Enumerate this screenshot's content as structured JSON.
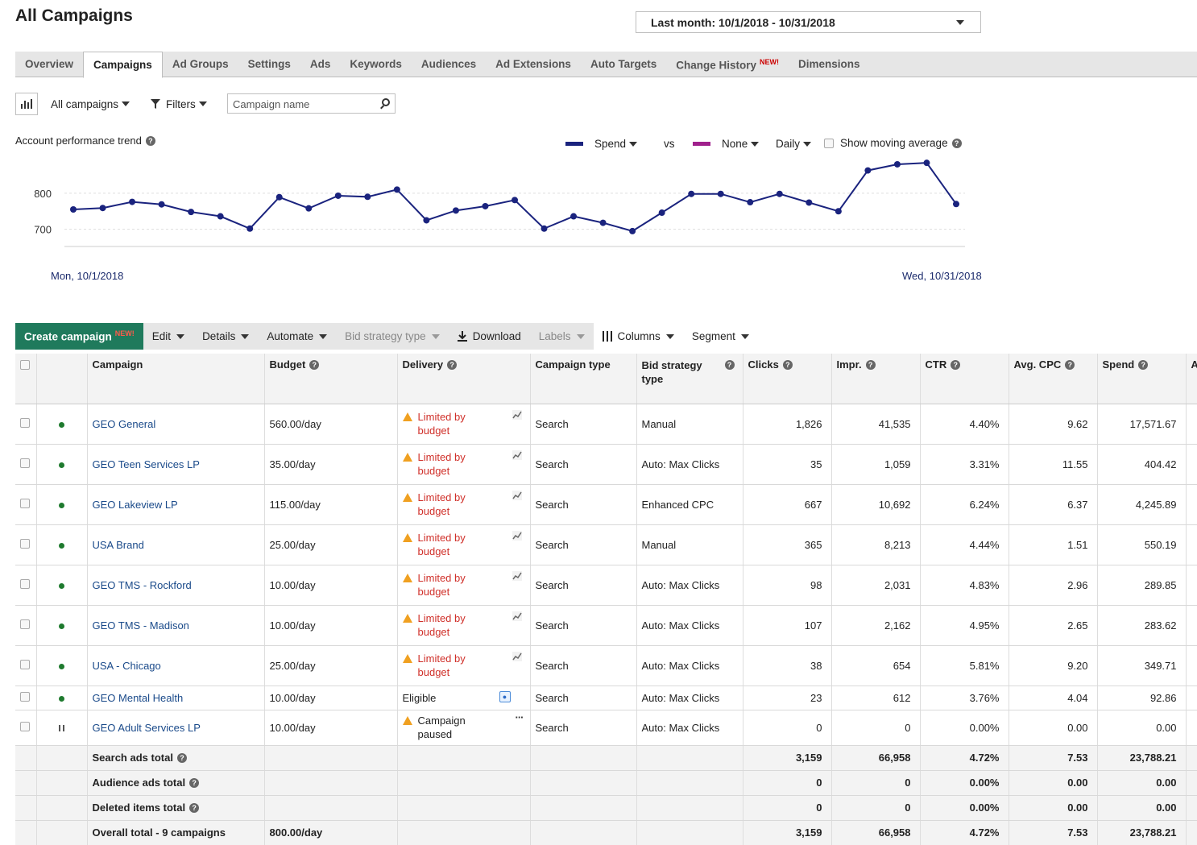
{
  "page": {
    "title": "All Campaigns",
    "date_range": "Last month: 10/1/2018 - 10/31/2018"
  },
  "tabs": [
    {
      "label": "Overview",
      "active": false
    },
    {
      "label": "Campaigns",
      "active": true
    },
    {
      "label": "Ad Groups",
      "active": false
    },
    {
      "label": "Settings",
      "active": false
    },
    {
      "label": "Ads",
      "active": false
    },
    {
      "label": "Keywords",
      "active": false
    },
    {
      "label": "Audiences",
      "active": false
    },
    {
      "label": "Ad Extensions",
      "active": false
    },
    {
      "label": "Auto Targets",
      "active": false
    },
    {
      "label": "Change History",
      "active": false,
      "badge": "NEW!"
    },
    {
      "label": "Dimensions",
      "active": false
    }
  ],
  "filterbar": {
    "scope": "All campaigns",
    "filters": "Filters",
    "search_placeholder": "Campaign name"
  },
  "trend": {
    "label": "Account performance trend",
    "metric1": "Spend",
    "vs": "vs",
    "metric2": "None",
    "granularity": "Daily",
    "moving_average": "Show moving average",
    "metric1_color": "#1a237e",
    "metric2_color": "#a0208c",
    "start_label": "Mon, 10/1/2018",
    "end_label": "Wed, 10/31/2018"
  },
  "chart_data": {
    "type": "line",
    "x": [
      "10/1",
      "10/2",
      "10/3",
      "10/4",
      "10/5",
      "10/6",
      "10/7",
      "10/8",
      "10/9",
      "10/10",
      "10/11",
      "10/12",
      "10/13",
      "10/14",
      "10/15",
      "10/16",
      "10/17",
      "10/18",
      "10/19",
      "10/20",
      "10/21",
      "10/22",
      "10/23",
      "10/24",
      "10/25",
      "10/26",
      "10/27",
      "10/28",
      "10/29",
      "10/30",
      "10/31"
    ],
    "series": [
      {
        "name": "Spend",
        "values": [
          755,
          759,
          776,
          769,
          748,
          736,
          702,
          789,
          758,
          793,
          790,
          810,
          725,
          752,
          764,
          781,
          702,
          736,
          718,
          695,
          746,
          798,
          798,
          775,
          798,
          774,
          750,
          863,
          880,
          884,
          770
        ]
      }
    ],
    "yticks": [
      700,
      800
    ],
    "ylim": [
      610,
      900
    ],
    "grid": true,
    "color": "#1a237e"
  },
  "toolbar": {
    "create": "Create campaign",
    "create_badge": "NEW!",
    "edit": "Edit",
    "details": "Details",
    "automate": "Automate",
    "bid_strategy": "Bid strategy type",
    "download": "Download",
    "labels": "Labels",
    "columns": "Columns",
    "segment": "Segment"
  },
  "table": {
    "headers": {
      "campaign": "Campaign",
      "budget": "Budget",
      "delivery": "Delivery",
      "type": "Campaign type",
      "bid": "Bid strategy type",
      "clicks": "Clicks",
      "impr": "Impr.",
      "ctr": "CTR",
      "cpc": "Avg. CPC",
      "spend": "Spend",
      "extra": "A"
    },
    "rows": [
      {
        "name": "GEO General",
        "status": "active",
        "budget": "560.00/day",
        "delivery": "limited",
        "type": "Search",
        "bid": "Manual",
        "clicks": "1,826",
        "impr": "41,535",
        "ctr": "4.40%",
        "cpc": "9.62",
        "spend": "17,571.67"
      },
      {
        "name": "GEO Teen Services LP",
        "status": "active",
        "budget": "35.00/day",
        "delivery": "limited",
        "type": "Search",
        "bid": "Auto: Max Clicks",
        "clicks": "35",
        "impr": "1,059",
        "ctr": "3.31%",
        "cpc": "11.55",
        "spend": "404.42"
      },
      {
        "name": "GEO Lakeview LP",
        "status": "active",
        "budget": "115.00/day",
        "delivery": "limited",
        "type": "Search",
        "bid": "Enhanced CPC",
        "clicks": "667",
        "impr": "10,692",
        "ctr": "6.24%",
        "cpc": "6.37",
        "spend": "4,245.89"
      },
      {
        "name": "USA Brand",
        "status": "active",
        "budget": "25.00/day",
        "delivery": "limited",
        "type": "Search",
        "bid": "Manual",
        "clicks": "365",
        "impr": "8,213",
        "ctr": "4.44%",
        "cpc": "1.51",
        "spend": "550.19"
      },
      {
        "name": "GEO TMS - Rockford",
        "status": "active",
        "budget": "10.00/day",
        "delivery": "limited",
        "type": "Search",
        "bid": "Auto: Max Clicks",
        "clicks": "98",
        "impr": "2,031",
        "ctr": "4.83%",
        "cpc": "2.96",
        "spend": "289.85"
      },
      {
        "name": "GEO TMS - Madison",
        "status": "active",
        "budget": "10.00/day",
        "delivery": "limited",
        "type": "Search",
        "bid": "Auto: Max Clicks",
        "clicks": "107",
        "impr": "2,162",
        "ctr": "4.95%",
        "cpc": "2.65",
        "spend": "283.62"
      },
      {
        "name": "USA - Chicago",
        "status": "active",
        "budget": "25.00/day",
        "delivery": "limited",
        "type": "Search",
        "bid": "Auto: Max Clicks",
        "clicks": "38",
        "impr": "654",
        "ctr": "5.81%",
        "cpc": "9.20",
        "spend": "349.71"
      },
      {
        "name": "GEO Mental Health",
        "status": "active",
        "budget": "10.00/day",
        "delivery": "eligible",
        "type": "Search",
        "bid": "Auto: Max Clicks",
        "clicks": "23",
        "impr": "612",
        "ctr": "3.76%",
        "cpc": "4.04",
        "spend": "92.86"
      },
      {
        "name": "GEO Adult Services LP",
        "status": "paused",
        "budget": "10.00/day",
        "delivery": "paused",
        "type": "Search",
        "bid": "Auto: Max Clicks",
        "clicks": "0",
        "impr": "0",
        "ctr": "0.00%",
        "cpc": "0.00",
        "spend": "0.00"
      }
    ],
    "delivery_text": {
      "limited_1": "Limited by",
      "limited_2": "budget",
      "eligible": "Eligible",
      "paused_1": "Campaign",
      "paused_2": "paused"
    },
    "totals": [
      {
        "label": "Search ads total",
        "help": true,
        "budget": "",
        "clicks": "3,159",
        "impr": "66,958",
        "ctr": "4.72%",
        "cpc": "7.53",
        "spend": "23,788.21"
      },
      {
        "label": "Audience ads total",
        "help": true,
        "budget": "",
        "clicks": "0",
        "impr": "0",
        "ctr": "0.00%",
        "cpc": "0.00",
        "spend": "0.00"
      },
      {
        "label": "Deleted items total",
        "help": true,
        "budget": "",
        "clicks": "0",
        "impr": "0",
        "ctr": "0.00%",
        "cpc": "0.00",
        "spend": "0.00"
      },
      {
        "label": "Overall total - 9 campaigns",
        "help": false,
        "budget": "800.00/day",
        "clicks": "3,159",
        "impr": "66,958",
        "ctr": "4.72%",
        "cpc": "7.53",
        "spend": "23,788.21"
      }
    ]
  }
}
